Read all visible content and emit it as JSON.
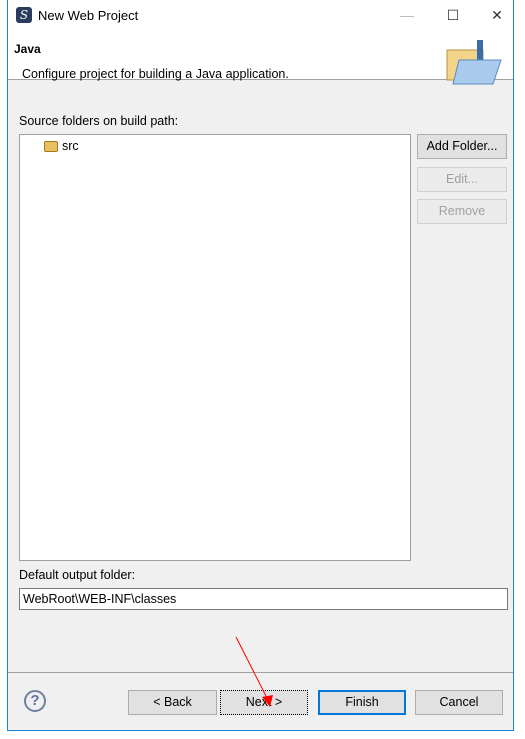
{
  "window": {
    "title": "New Web Project",
    "app_icon": "myeclipse-icon"
  },
  "header": {
    "title": "Java",
    "description": "Configure project for building a Java application.",
    "banner_icon": "java-folder-icon"
  },
  "source": {
    "label": "Source folders on build path:",
    "items": [
      {
        "label": "src",
        "icon": "package-folder-icon"
      }
    ]
  },
  "side_buttons": {
    "add": "Add Folder...",
    "edit": "Edit...",
    "remove": "Remove"
  },
  "output": {
    "label": "Default output folder:",
    "value": "WebRoot\\WEB-INF\\classes"
  },
  "footer": {
    "back": "< Back",
    "next": "Next >",
    "finish": "Finish",
    "cancel": "Cancel"
  },
  "annotation": {
    "color": "#ff0000"
  }
}
